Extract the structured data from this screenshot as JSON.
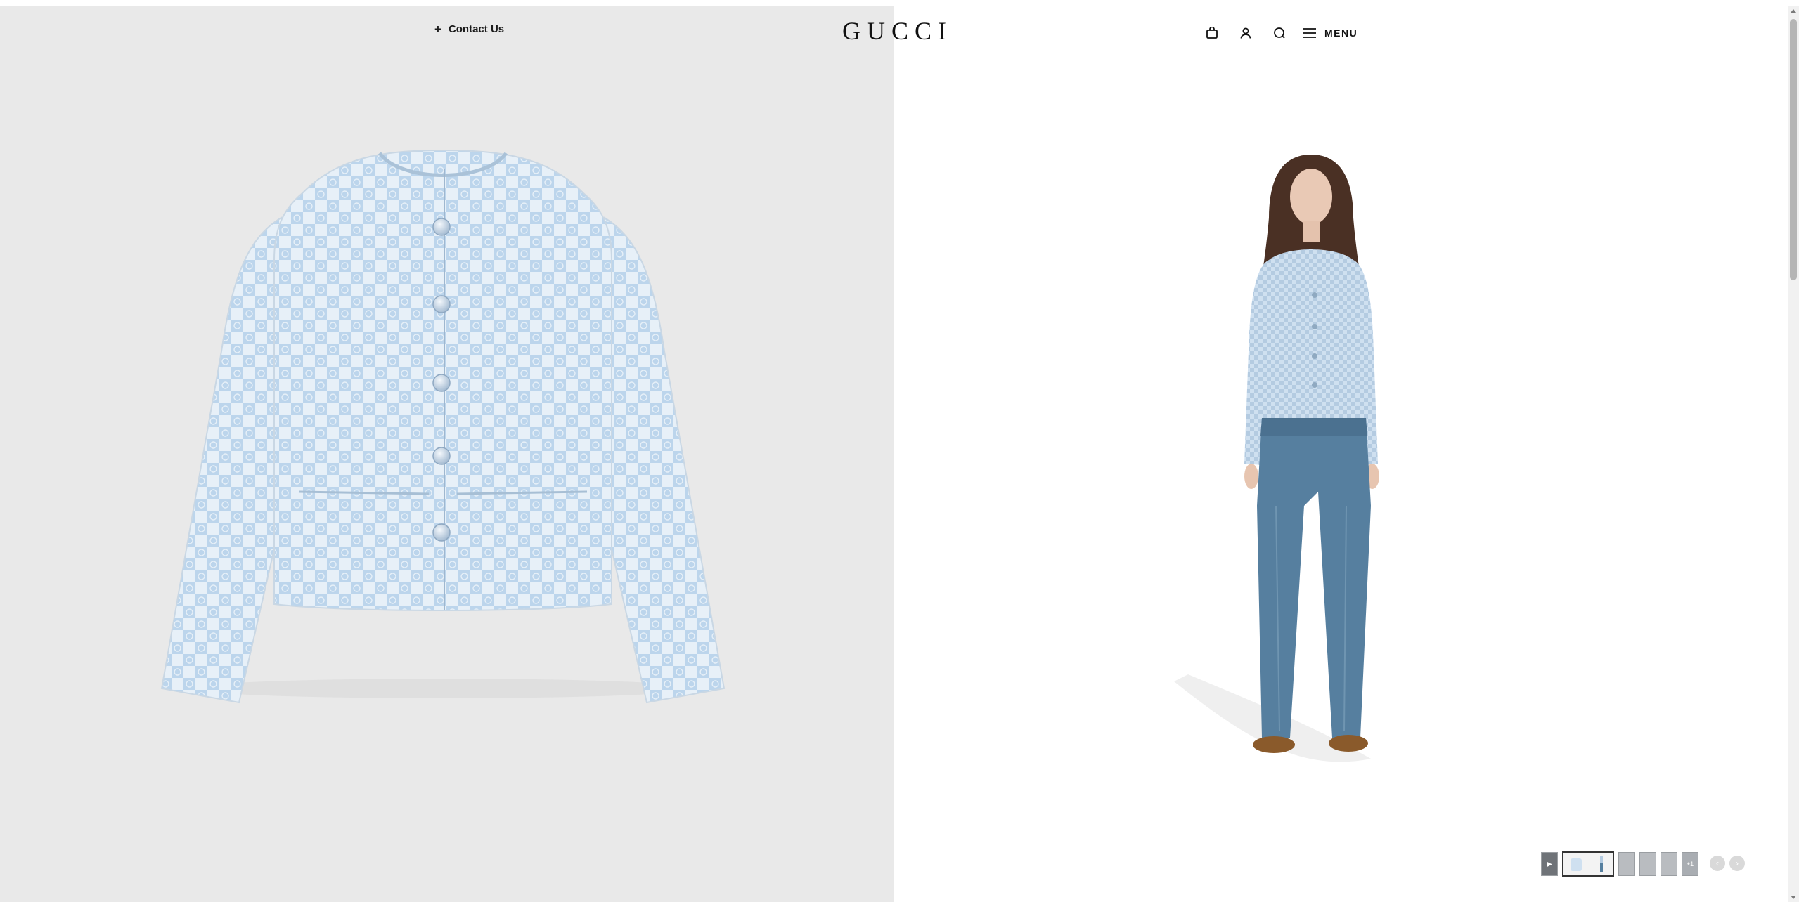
{
  "header": {
    "contact_plus": "+",
    "contact_label": "Contact Us",
    "logo": "GUCCI",
    "menu_label": "MENU",
    "icons": [
      "shopping-bag-icon",
      "account-icon",
      "search-icon",
      "hamburger-icon"
    ]
  },
  "product_images": {
    "main_left": "jacket-flat-lay",
    "main_right": "model-wearing-jacket"
  },
  "thumbnails": {
    "play_glyph": "▶",
    "more_label": "+1",
    "prev_glyph": "‹",
    "next_glyph": "›"
  },
  "colors": {
    "left_bg": "#e9e9e9",
    "jacket_blue": "#b9d3ec",
    "jacket_light": "#e8f1f9",
    "denim": "#4f7a9c"
  }
}
